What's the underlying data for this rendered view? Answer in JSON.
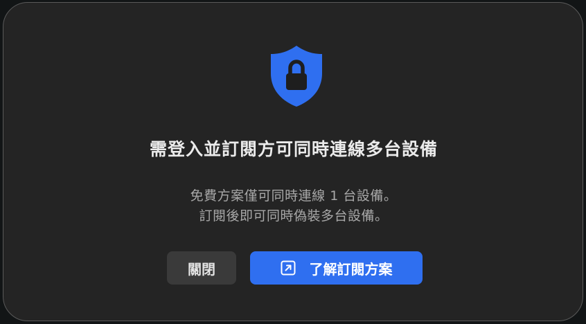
{
  "dialog": {
    "icon": "shield-lock-icon",
    "title": "需登入並訂閱方可同時連線多台設備",
    "message_lines": [
      "免費方案僅可同時連線 1 台設備。",
      "訂閱後即可同時偽裝多台設備。"
    ],
    "buttons": {
      "close_label": "關閉",
      "learn_more_label": "了解訂閱方案",
      "learn_more_icon": "external-link-icon"
    }
  },
  "colors": {
    "dialog_background": "#242424",
    "accent": "#2f6ff0",
    "secondary_button": "#3a3a3a",
    "title_text": "#ebebeb",
    "message_text": "#a8a8a8"
  }
}
